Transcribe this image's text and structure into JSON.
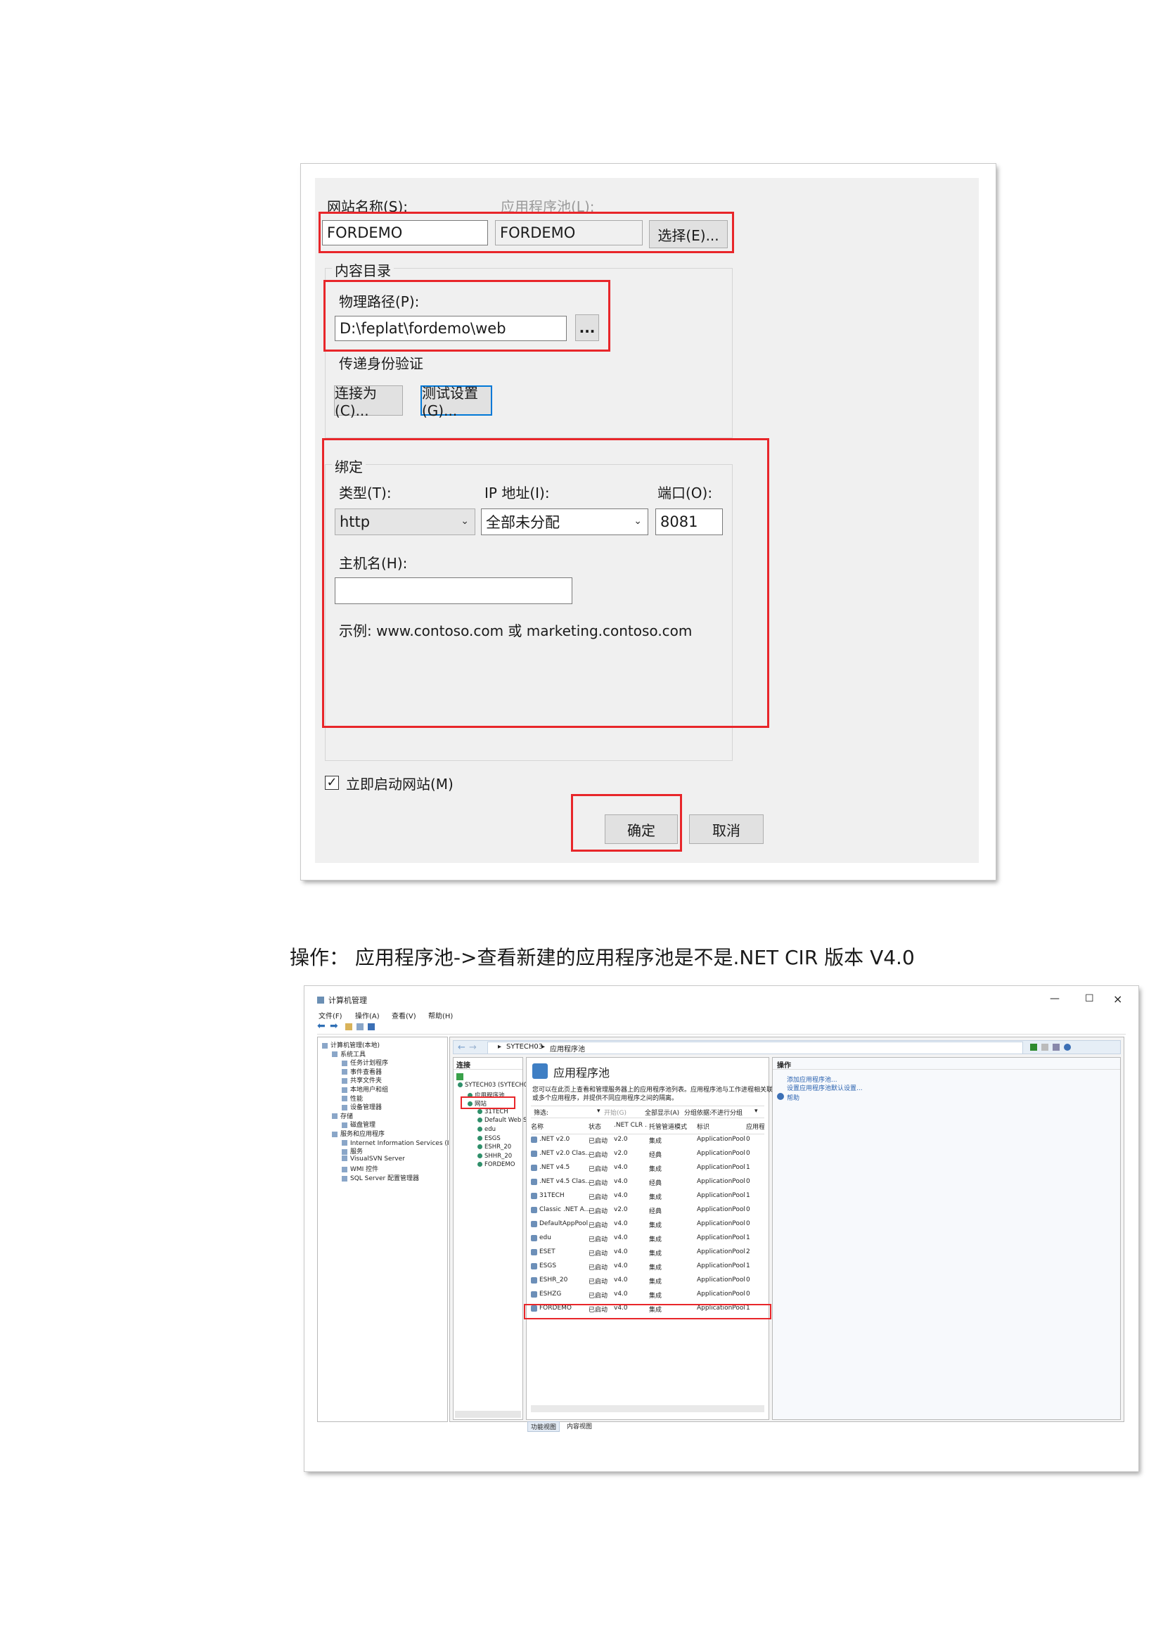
{
  "dialog": {
    "site_name_label": "网站名称(S):",
    "site_name_value": "FORDEMO",
    "app_pool_label": "应用程序池(L):",
    "app_pool_value": "FORDEMO",
    "select_button": "选择(E)...",
    "content_dir_title": "内容目录",
    "physical_path_label": "物理路径(P):",
    "physical_path_value": "D:\\feplat\\fordemo\\web",
    "browse_button": "...",
    "pass_auth_label": "传递身份验证",
    "connect_as_button": "连接为(C)...",
    "test_settings_button": "测试设置(G)...",
    "binding_title": "绑定",
    "type_label": "类型(T):",
    "type_value": "http",
    "ip_label": "IP 地址(I):",
    "ip_value": "全部未分配",
    "port_label": "端口(O):",
    "port_value": "8081",
    "hostname_label": "主机名(H):",
    "hostname_value": "",
    "example_text": "示例: www.contoso.com 或 marketing.contoso.com",
    "start_now_label": "立即启动网站(M)",
    "start_now_checked": true,
    "ok_button": "确定",
    "cancel_button": "取消"
  },
  "caption": "操作：  应用程序池->查看新建的应用程序池是不是.NET CIR 版本  V4.0",
  "mmc": {
    "window_title": "计算机管理",
    "controls": [
      "—",
      "☐",
      "×"
    ],
    "menu": [
      "文件(F)",
      "操作(A)",
      "查看(V)",
      "帮助(H)"
    ],
    "tree": [
      {
        "label": "计算机管理(本地)",
        "level": 0
      },
      {
        "label": "系统工具",
        "level": 1
      },
      {
        "label": "任务计划程序",
        "level": 2
      },
      {
        "label": "事件查看器",
        "level": 2
      },
      {
        "label": "共享文件夹",
        "level": 2
      },
      {
        "label": "本地用户和组",
        "level": 2
      },
      {
        "label": "性能",
        "level": 2
      },
      {
        "label": "设备管理器",
        "level": 2
      },
      {
        "label": "存储",
        "level": 1
      },
      {
        "label": "磁盘管理",
        "level": 2
      },
      {
        "label": "服务和应用程序",
        "level": 1
      },
      {
        "label": "Internet Information Services (IIS)管理器",
        "level": 2
      },
      {
        "label": "服务",
        "level": 2
      },
      {
        "label": "VisualSVN Server",
        "level": 2
      },
      {
        "label": "WMI 控件",
        "level": 2
      },
      {
        "label": "SQL Server 配置管理器",
        "level": 2
      }
    ],
    "address": [
      "SYTECH03",
      "应用程序池"
    ],
    "conn_title": "连接",
    "conn_tree": [
      {
        "label": "SYTECH03 (SYTECH0",
        "level": 0
      },
      {
        "label": "应用程序池",
        "level": 1
      },
      {
        "label": "网站",
        "level": 1
      },
      {
        "label": "31TECH",
        "level": 2
      },
      {
        "label": "Default Web S",
        "level": 2
      },
      {
        "label": "edu",
        "level": 2
      },
      {
        "label": "ESGS",
        "level": 2
      },
      {
        "label": "ESHR_20",
        "level": 2
      },
      {
        "label": "SHHR_20",
        "level": 2
      },
      {
        "label": "FORDEMO",
        "level": 2
      }
    ],
    "pools_title": "应用程序池",
    "pools_desc_1": "您可以在此页上查看和管理服务器上的应用程序池列表。应用程序池与工作进程相关联，包含一个",
    "pools_desc_2": "或多个应用程序，并提供不同应用程序之间的隔离。",
    "filter": {
      "label": "筛选:",
      "start": "开始(G)",
      "show_all": "全部显示(A)",
      "group_by_label": "分组依据:",
      "group_by_value": "不进行分组"
    },
    "columns": [
      "名称",
      "状态",
      ".NET CLR ...",
      "托管管道模式",
      "标识",
      "应用程序"
    ],
    "rows": [
      [
        ".NET v2.0",
        "已启动",
        "v2.0",
        "集成",
        "ApplicationPooll...",
        "0"
      ],
      [
        ".NET v2.0 Clas...",
        "已启动",
        "v2.0",
        "经典",
        "ApplicationPooll...",
        "0"
      ],
      [
        ".NET v4.5",
        "已启动",
        "v4.0",
        "集成",
        "ApplicationPooll...",
        "1"
      ],
      [
        ".NET v4.5 Clas...",
        "已启动",
        "v4.0",
        "经典",
        "ApplicationPooll...",
        "0"
      ],
      [
        "31TECH",
        "已启动",
        "v4.0",
        "集成",
        "ApplicationPooll...",
        "1"
      ],
      [
        "Classic .NET A...",
        "已启动",
        "v2.0",
        "经典",
        "ApplicationPooll...",
        "0"
      ],
      [
        "DefaultAppPool",
        "已启动",
        "v4.0",
        "集成",
        "ApplicationPooll...",
        "0"
      ],
      [
        "edu",
        "已启动",
        "v4.0",
        "集成",
        "ApplicationPooll...",
        "1"
      ],
      [
        "ESET",
        "已启动",
        "v4.0",
        "集成",
        "ApplicationPooll...",
        "2"
      ],
      [
        "ESGS",
        "已启动",
        "v4.0",
        "集成",
        "ApplicationPooll...",
        "1"
      ],
      [
        "ESHR_20",
        "已启动",
        "v4.0",
        "集成",
        "ApplicationPooll...",
        "0"
      ],
      [
        "ESHZG",
        "已启动",
        "v4.0",
        "集成",
        "ApplicationPooll...",
        "0"
      ],
      [
        "FORDEMO",
        "已启动",
        "v4.0",
        "集成",
        "ApplicationPooll...",
        "1"
      ]
    ],
    "bottom_tabs": [
      "功能视图",
      "内容视图"
    ],
    "actions_title": "操作",
    "actions": [
      "添加应用程序池...",
      "设置应用程序池默认设置...",
      "帮助"
    ]
  },
  "colors": {
    "highlight_red": "#e8262a",
    "focus_blue": "#0078d7",
    "dialog_bg": "#f0f0f0"
  }
}
